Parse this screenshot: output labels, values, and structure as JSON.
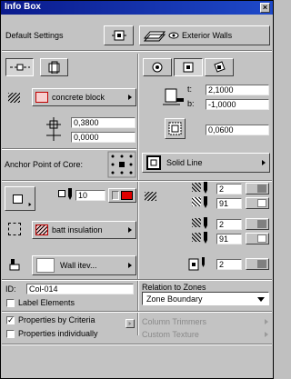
{
  "window": {
    "title": "Info Box"
  },
  "top": {
    "settings_label": "Default Settings",
    "view_label": "Exterior Walls"
  },
  "material": {
    "name": "concrete block",
    "t_label": "t:",
    "t_value": "2,1000",
    "b_label": "b:",
    "b_value": "-1,0000",
    "dim1": "0,3800",
    "dim2": "0,0000",
    "dim3": "0,0600"
  },
  "anchor": {
    "label": "Anchor Point of Core:",
    "line_type": "Solid Line"
  },
  "pens": {
    "contour_pen": "10",
    "fill_pen_1": "2",
    "fill_pen_2": "91",
    "fill_pen_3": "2",
    "fill_pen_4": "91",
    "section_pen": "2",
    "contour_color": "#e00000"
  },
  "insulation": {
    "name": "batt insulation"
  },
  "layer": {
    "name": "Wall itev..."
  },
  "id": {
    "label": "ID:",
    "value": "Col-014"
  },
  "zones": {
    "label": "Relation to Zones",
    "value": "Zone Boundary"
  },
  "checks": {
    "label_elements": "Label Elements",
    "props_by_criteria": "Properties by Criteria",
    "props_by_criteria_checked": "✓",
    "props_individually": "Properties individually"
  },
  "extras": {
    "column_trimmers": "Column Trimmers",
    "custom_texture": "Custom Texture"
  }
}
